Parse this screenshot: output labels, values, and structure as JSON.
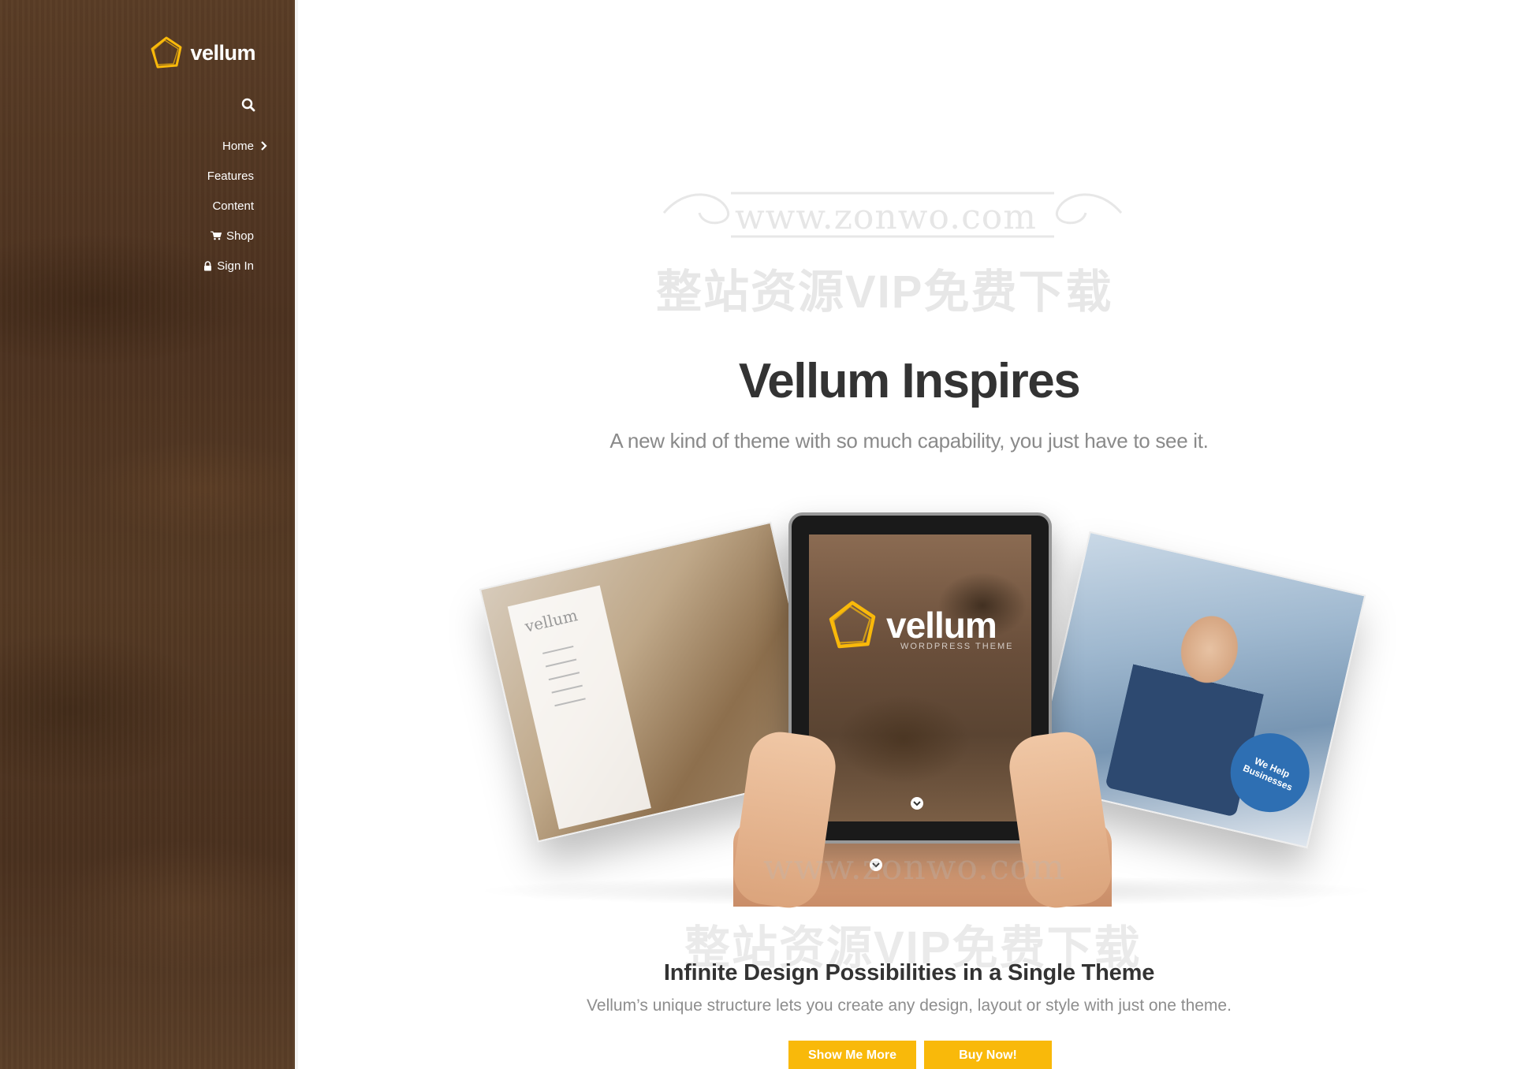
{
  "brand": {
    "name": "vellum",
    "accent": "#f9b90a"
  },
  "nav": {
    "items": [
      {
        "label": "Home",
        "icon": "chevron-right-icon"
      },
      {
        "label": "Features"
      },
      {
        "label": "Content"
      },
      {
        "label": "Shop",
        "icon": "cart-icon"
      },
      {
        "label": "Sign In",
        "icon": "lock-icon"
      }
    ]
  },
  "hero": {
    "title": "Vellum Inspires",
    "subtitle": "A new kind of theme with so much capability, you just have to see it."
  },
  "devices": {
    "left_screen_logo": "vellum",
    "tablet_logo": "vellum",
    "tablet_tagline": "WORDPRESS THEME",
    "right_screen_badge": "We Help Businesses"
  },
  "watermark": {
    "url": "www.zonwo.com",
    "text": "整站资源VIP免费下载"
  },
  "section": {
    "title": "Infinite Design Possibilities in a Single Theme",
    "subtitle": "Vellum’s unique structure lets you create any design, layout or style with just one theme."
  },
  "buttons": {
    "show_more": "Show Me More",
    "buy_now": "Buy Now!"
  }
}
